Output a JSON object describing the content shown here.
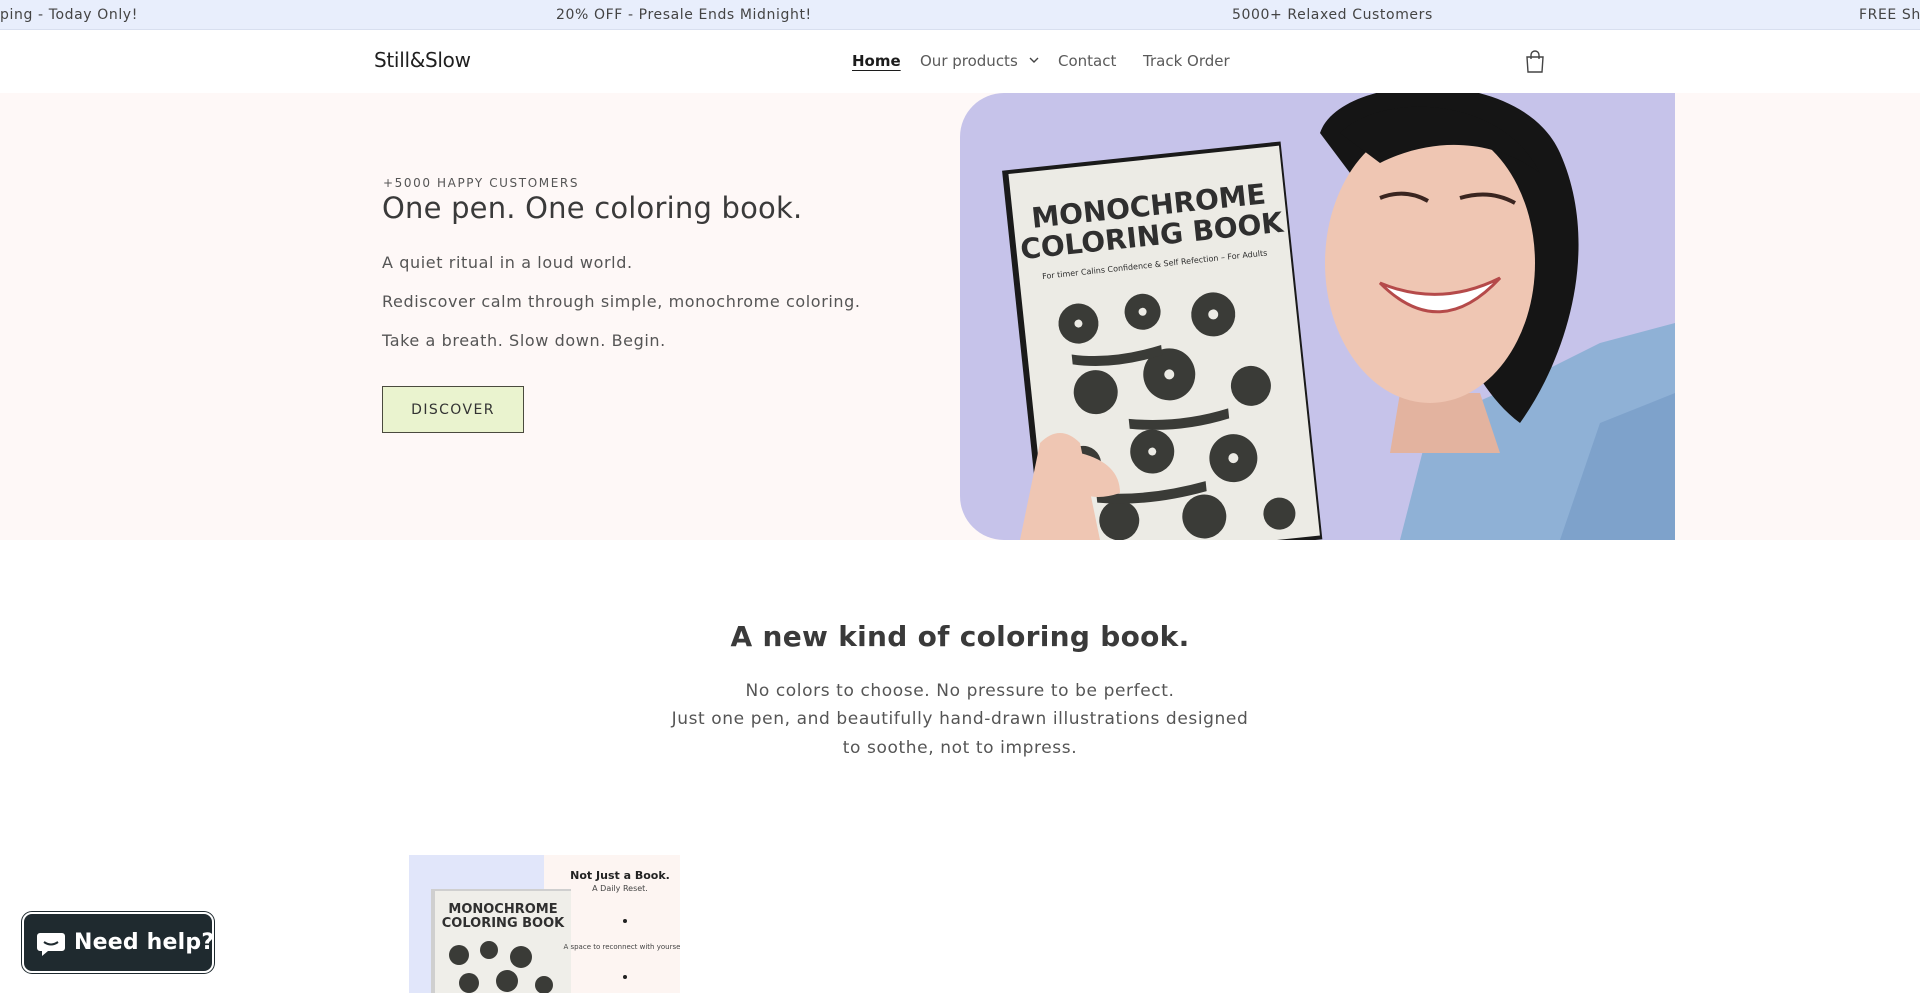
{
  "announcement": {
    "items": [
      "ping - Today Only!",
      "20% OFF - Presale Ends Midnight!",
      "5000+ Relaxed Customers",
      "FREE Ship"
    ]
  },
  "header": {
    "logo": "Still&Slow",
    "nav": {
      "home": "Home",
      "products": "Our products",
      "contact": "Contact",
      "track": "Track Order"
    },
    "cart_icon": "shopping-bag-icon"
  },
  "hero": {
    "eyebrow": "+5000 HAPPY CUSTOMERS",
    "title": "One pen. One coloring book.",
    "line1": "A quiet ritual in a loud world.",
    "line2": "Rediscover calm through simple, monochrome coloring.",
    "line3": "Take a breath. Slow down. Begin.",
    "cta": "DISCOVER",
    "book": {
      "title_line1": "MONOCHROME",
      "title_line2": "COLORING BOOK",
      "subtitle": "For timer Calins Confidence & Self Refection – For Adults"
    }
  },
  "section2": {
    "title": "A new kind of coloring book.",
    "line1": "No colors to choose. No pressure to be perfect.",
    "line2": "Just one pen, and beautifully hand-drawn illustrations designed",
    "line3": "to soothe, not to impress."
  },
  "product_preview": {
    "book_title_line1": "MONOCHROME",
    "book_title_line2": "COLORING BOOK",
    "heading": "Not Just a Book.",
    "subheading": "A Daily Reset.",
    "bullet": "A space to reconnect with yourself."
  },
  "chat": {
    "label": "Need help?"
  },
  "colors": {
    "announce_bg": "#e8eefc",
    "hero_bg": "#fef8f7",
    "hero_photo_bg": "#c6c3ea",
    "cta_bg": "#eaf3cf",
    "chat_bg": "#1f2a2f"
  }
}
